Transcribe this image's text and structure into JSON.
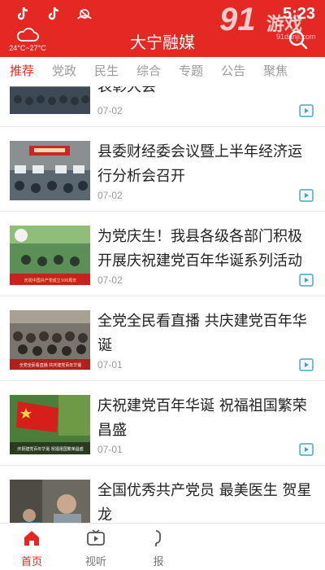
{
  "status_bar": {
    "time": "5:23",
    "icons": [
      "tiktok-icon",
      "tiktok-icon",
      "app-icon",
      "wifi-icon",
      "signal-icon"
    ]
  },
  "watermark": {
    "brand": "91",
    "text": "游戏",
    "site": "91danji.com"
  },
  "header": {
    "title": "大宁融媒",
    "weather": {
      "icon": "cloud-icon",
      "temperature": "24°C~27°C"
    },
    "search_icon": "search-icon"
  },
  "tabs": [
    {
      "label": "推荐",
      "active": true
    },
    {
      "label": "党政",
      "active": false
    },
    {
      "label": "民生",
      "active": false
    },
    {
      "label": "综合",
      "active": false
    },
    {
      "label": "专题",
      "active": false
    },
    {
      "label": "公告",
      "active": false
    },
    {
      "label": "聚焦",
      "active": false
    }
  ],
  "articles": [
    {
      "title": "表彰大会",
      "date": "07-02",
      "thumb_text": ""
    },
    {
      "title": "县委财经委会议暨上半年经济运行分析会召开",
      "date": "07-02",
      "thumb_text": ""
    },
    {
      "title": "为党庆生！我县各级各部门积极开展庆祝建党百年华诞系列活动",
      "date": "07-02",
      "thumb_text": "庆祝中国共产党成立100周年"
    },
    {
      "title": "全党全民看直播 共庆建党百年华诞",
      "date": "07-01",
      "thumb_text": "全党全民看直播 共庆建党百年华诞"
    },
    {
      "title": "庆祝建党百年华诞 祝福祖国繁荣昌盛",
      "date": "07-01",
      "thumb_text": "庆祝建党百年华诞 祝福祖国繁荣昌盛"
    },
    {
      "title": "全国优秀共产党员 最美医生 贺星龙",
      "date": "",
      "thumb_text": ""
    }
  ],
  "bottom_nav": [
    {
      "label": "首页",
      "icon": "home-icon",
      "active": true
    },
    {
      "label": "视听",
      "icon": "tv-icon",
      "active": false
    },
    {
      "label": "报",
      "icon": "mic-icon",
      "active": false
    }
  ],
  "colors": {
    "brand_red": "#e42823",
    "text": "#222222",
    "muted": "#999999"
  }
}
